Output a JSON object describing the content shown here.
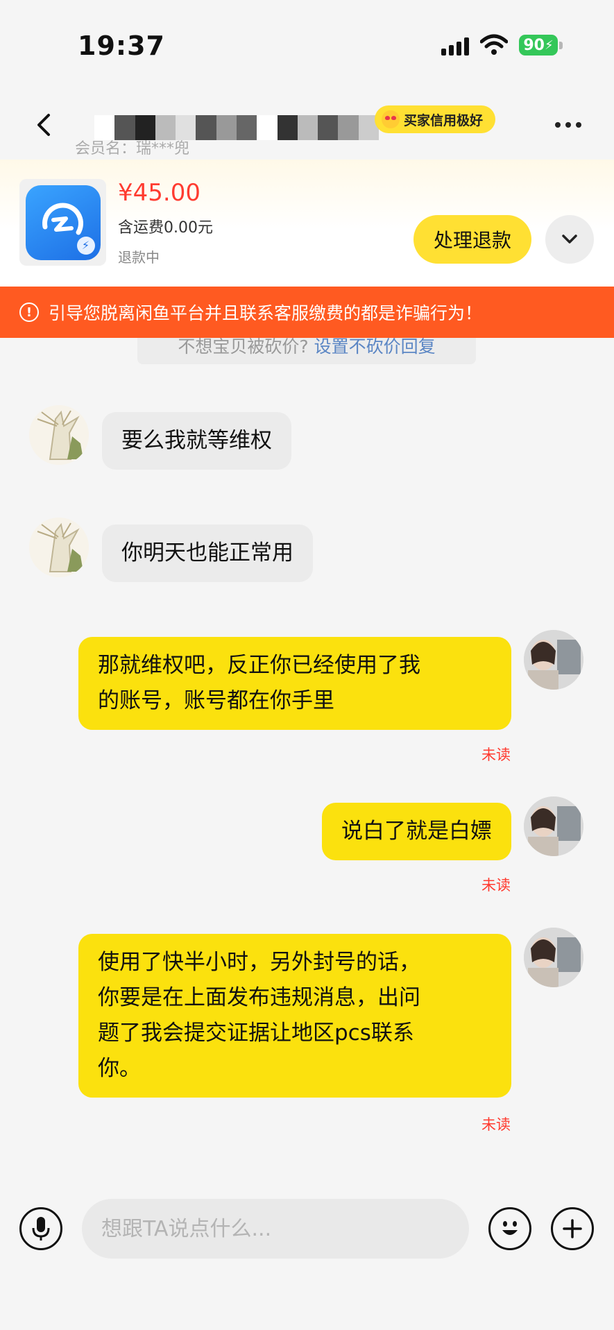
{
  "status_bar": {
    "time": "19:37",
    "battery": "90"
  },
  "header": {
    "badge": "买家信用极好",
    "member_label": "会员名：瑞***兜"
  },
  "product": {
    "price": "¥45.00",
    "shipping": "含运费0.00元",
    "status": "退款中",
    "refund_button": "处理退款"
  },
  "warning": "引导您脱离闲鱼平台并且联系客服缴费的都是诈骗行为！",
  "tip": {
    "text": "不想宝贝被砍价?",
    "link": "设置不砍价回复"
  },
  "messages": [
    {
      "side": "in",
      "text": "要么我就等维权"
    },
    {
      "side": "in",
      "text": "你明天也能正常用"
    },
    {
      "side": "out",
      "line1": "那就维权吧，反正你已经使用了我",
      "line2": "的账号，账号都在你手里",
      "status": "未读"
    },
    {
      "side": "out",
      "text": "说白了就是白嫖",
      "status": "未读"
    },
    {
      "side": "out",
      "line1": "使用了快半小时，另外封号的话，",
      "line2": "你要是在上面发布违规消息，出问",
      "line3": "题了我会提交证据让地区pcs联系",
      "line4": "你。",
      "status": "未读"
    }
  ],
  "input": {
    "placeholder": "想跟TA说点什么..."
  },
  "icons": [
    "back-icon",
    "more-icon",
    "chevron-down-icon",
    "warning-icon",
    "microphone-icon",
    "emoji-icon",
    "plus-icon"
  ],
  "colors": {
    "accent_yellow": "#fbe10e",
    "warning_orange": "#ff5a21",
    "price_red": "#ff3b30"
  }
}
